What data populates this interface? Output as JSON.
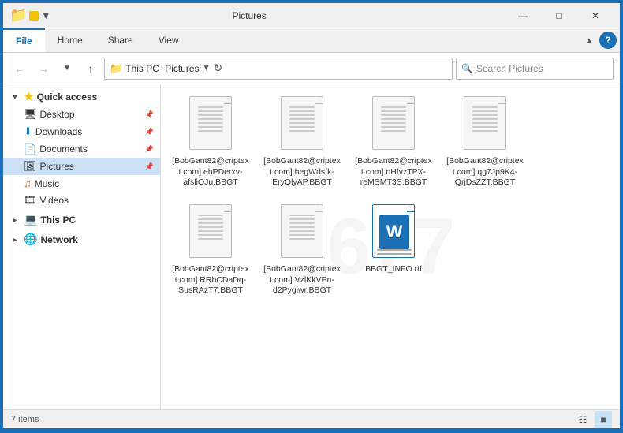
{
  "window": {
    "title": "Pictures",
    "controls": {
      "minimize": "—",
      "maximize": "□",
      "close": "✕"
    }
  },
  "ribbon": {
    "tabs": [
      "File",
      "Home",
      "Share",
      "View"
    ],
    "active_tab": "File"
  },
  "nav": {
    "back_disabled": true,
    "forward_disabled": true,
    "up": "↑",
    "path": "This PC › Pictures",
    "path_parts": [
      "This PC",
      "Pictures"
    ],
    "search_placeholder": "Search Pictures",
    "refresh": "↻"
  },
  "sidebar": {
    "quick_access_label": "Quick access",
    "items_quick": [
      {
        "label": "Desktop",
        "pin": true
      },
      {
        "label": "Downloads",
        "pin": true
      },
      {
        "label": "Documents",
        "pin": true
      },
      {
        "label": "Pictures",
        "pin": true,
        "selected": true
      },
      {
        "label": "Music"
      },
      {
        "label": "Videos"
      }
    ],
    "this_pc_label": "This PC",
    "network_label": "Network"
  },
  "files": [
    {
      "name": "[BobGant82@criptext.com].ehPDerxv-afsliOJu.BBGT",
      "type": "generic"
    },
    {
      "name": "[BobGant82@criptext.com].hegWdsfk-EryOlyAP.BBGT",
      "type": "generic"
    },
    {
      "name": "[BobGant82@criptext.com].nHfvzTPX-reMSMT3S.BBGT",
      "type": "generic"
    },
    {
      "name": "[BobGant82@criptext.com].qg7Jp9K4-QrjDsZZT.BBGT",
      "type": "generic"
    },
    {
      "name": "[BobGant82@criptext.com].RRbCDaDq-SusRAzT7.BBGT",
      "type": "generic"
    },
    {
      "name": "[BobGant82@criptext.com].VzlKkVPn-d2Pygiwr.BBGT",
      "type": "generic"
    },
    {
      "name": "BBGT_INFO.rtf",
      "type": "rtf"
    }
  ],
  "status": {
    "item_count": "7 items"
  },
  "colors": {
    "accent": "#1a6fb5",
    "sidebar_selected": "#cce0f5"
  }
}
